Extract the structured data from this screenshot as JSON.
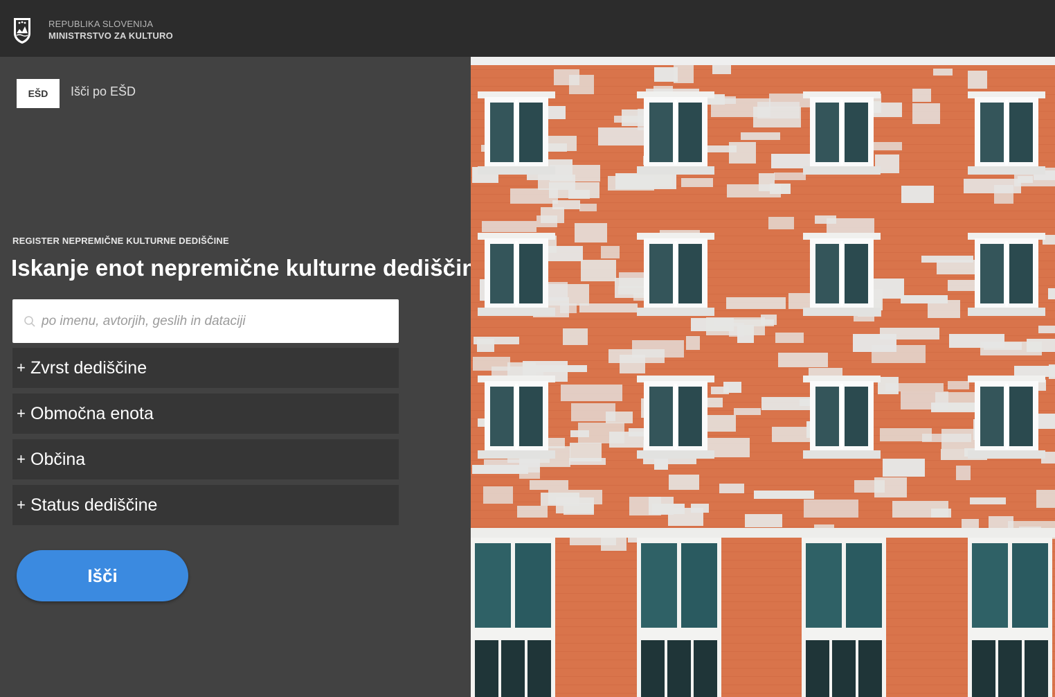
{
  "header": {
    "country_line": "REPUBLIKA SLOVENIJA",
    "ministry_line": "MINISTRSTVO ZA KULTURO",
    "logo_icon": "slovenia-crest-icon"
  },
  "esd": {
    "button_label": "EŠD",
    "link_label": "Išči po EŠD"
  },
  "main": {
    "section_label": "REGISTER NEPREMIČNE KULTURNE DEDIŠČINE",
    "title": "Iskanje enot nepremične kulturne dediščine",
    "search": {
      "placeholder": "po imenu, avtorjih, geslih in dataciji",
      "value": "",
      "icon": "search-icon"
    },
    "filters": [
      {
        "label": "Zvrst dediščine",
        "icon": "plus-icon"
      },
      {
        "label": "Območna enota",
        "icon": "plus-icon"
      },
      {
        "label": "Občina",
        "icon": "plus-icon"
      },
      {
        "label": "Status dediščine",
        "icon": "plus-icon"
      }
    ],
    "search_button_label": "Išči"
  },
  "colors": {
    "topbar": "#2c2c2c",
    "panel": "#424242",
    "filter_row": "#363636",
    "accent": "#3b8ae0",
    "brick": "#d9744b",
    "stone": "#e6e6e4"
  },
  "hero_image": {
    "subject": "brick-and-stone-building-facade"
  }
}
